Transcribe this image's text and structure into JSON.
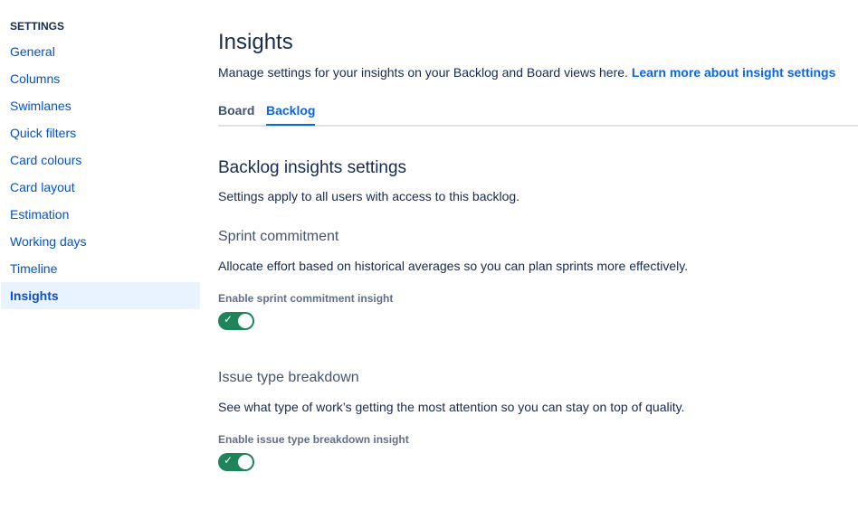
{
  "sidebar": {
    "title": "SETTINGS",
    "items": [
      {
        "label": "General"
      },
      {
        "label": "Columns"
      },
      {
        "label": "Swimlanes"
      },
      {
        "label": "Quick filters"
      },
      {
        "label": "Card colours"
      },
      {
        "label": "Card layout"
      },
      {
        "label": "Estimation"
      },
      {
        "label": "Working days"
      },
      {
        "label": "Timeline"
      },
      {
        "label": "Insights"
      }
    ]
  },
  "main": {
    "title": "Insights",
    "description": "Manage settings for your insights on your Backlog and Board views here.",
    "learn_more": "Learn more about insight settings",
    "tabs": [
      {
        "label": "Board"
      },
      {
        "label": "Backlog"
      }
    ],
    "section_title": "Backlog insights settings",
    "section_desc": "Settings apply to all users with access to this backlog.",
    "sprint": {
      "title": "Sprint commitment",
      "desc": "Allocate effort based on historical averages so you can plan sprints more effectively.",
      "toggle_label": "Enable sprint commitment insight",
      "enabled": true
    },
    "issue": {
      "title": "Issue type breakdown",
      "desc": "See what type of work’s getting the most attention so you can stay on top of quality.",
      "toggle_label": "Enable issue type breakdown insight",
      "enabled": true
    }
  }
}
